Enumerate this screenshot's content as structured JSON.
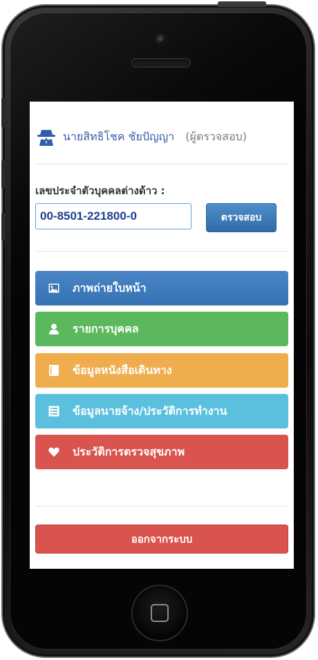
{
  "header": {
    "user_name": "นายสิทธิโชค ชัยปัญญา",
    "role": "(ผู้ตรวจสอบ)"
  },
  "id_check": {
    "label": "เลขประจำตัวบุคคลต่างด้าว :",
    "value": "00-8501-221800-0",
    "button_label": "ตรวจสอบ"
  },
  "menu": {
    "items": [
      {
        "label": "ภาพถ่ายใบหน้า",
        "icon": "image-icon",
        "color": "#3a77b8"
      },
      {
        "label": "รายการบุคคล",
        "icon": "user-icon",
        "color": "#5cb85c"
      },
      {
        "label": "ข้อมูลหนังสือเดินทาง",
        "icon": "book-icon",
        "color": "#f0ad4e"
      },
      {
        "label": "ข้อมูลนายจ้าง/ประวัติการทำงาน",
        "icon": "list-alt-icon",
        "color": "#5bc0de"
      },
      {
        "label": "ประวัติการตรวจสุขภาพ",
        "icon": "heart-icon",
        "color": "#d9534f"
      }
    ]
  },
  "logout": {
    "label": "ออกจากระบบ",
    "color": "#d9534f"
  }
}
